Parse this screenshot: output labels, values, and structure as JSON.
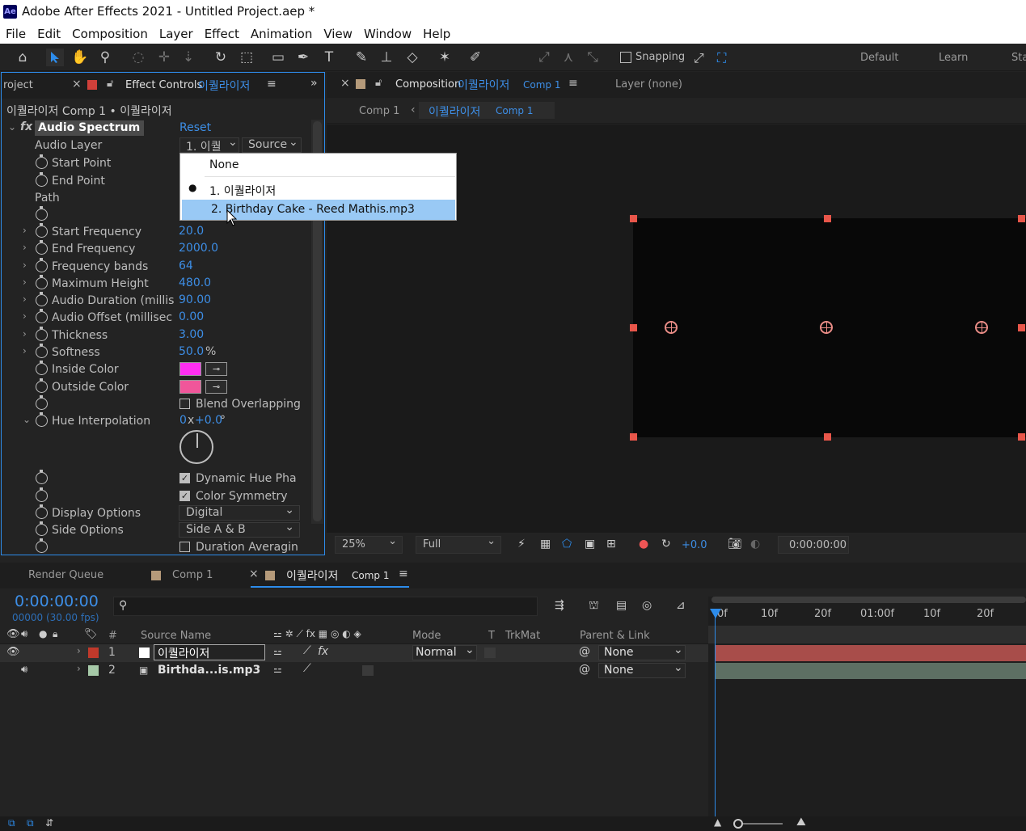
{
  "app": {
    "title": "Adobe After Effects 2021 - Untitled Project.aep *",
    "logo": "Ae"
  },
  "menu": [
    "File",
    "Edit",
    "Composition",
    "Layer",
    "Effect",
    "Animation",
    "View",
    "Window",
    "Help"
  ],
  "toolbar": {
    "snapping_label": "Snapping",
    "workspaces": [
      "Default",
      "Learn",
      "Sta"
    ]
  },
  "left_panel": {
    "tab_project": "roject",
    "tab_effect_controls": "Effect Controls",
    "tab_effect_controls_layer": "이퀄라이저",
    "breadcrumb": "이퀄라이저 Comp 1 • 이퀄라이저",
    "effect": {
      "name": "Audio Spectrum",
      "reset": "Reset",
      "audio_layer_label": "Audio Layer",
      "audio_layer_value": "1. 이퀄",
      "audio_layer_source": "Source",
      "props": {
        "start_point": "Start Point",
        "end_point": "End Point",
        "path": "Path",
        "start_frequency": {
          "label": "Start Frequency",
          "value": "20.0"
        },
        "end_frequency": {
          "label": "End Frequency",
          "value": "2000.0"
        },
        "frequency_bands": {
          "label": "Frequency bands",
          "value": "64"
        },
        "maximum_height": {
          "label": "Maximum Height",
          "value": "480.0"
        },
        "audio_duration": {
          "label": "Audio Duration (millis",
          "value": "90.00"
        },
        "audio_offset": {
          "label": "Audio Offset (millisec",
          "value": "0.00"
        },
        "thickness": {
          "label": "Thickness",
          "value": "3.00"
        },
        "softness": {
          "label": "Softness",
          "value": "50.0",
          "unit": "%"
        },
        "inside_color": {
          "label": "Inside Color",
          "color": "#ff2ef2"
        },
        "outside_color": {
          "label": "Outside Color",
          "color": "#f0569a"
        },
        "blend_overlapping": "Blend Overlapping",
        "hue_interpolation": {
          "label": "Hue Interpolation",
          "rev": "0",
          "x": "x",
          "deg": "+0.0",
          "unit": "°"
        },
        "dynamic_hue_phase": "Dynamic Hue Pha",
        "color_symmetry": "Color Symmetry",
        "display_options": {
          "label": "Display Options",
          "value": "Digital"
        },
        "side_options": {
          "label": "Side Options",
          "value": "Side A & B"
        },
        "duration_averaging": "Duration Averagin"
      }
    }
  },
  "popup": {
    "items": [
      "None",
      "1. 이퀄라이저",
      "2. Birthday Cake - Reed Mathis.mp3"
    ],
    "checked_index": 1,
    "highlighted_index": 2
  },
  "comp_panel": {
    "tab_label": "Composition",
    "tab_comp_name": "이퀄라이저",
    "tab_comp_suffix": "Comp 1",
    "layer_tab": "Layer (none)",
    "sub_comp1": "Comp 1",
    "sub_active_name": "이퀄라이저",
    "sub_active_suffix": "Comp 1",
    "zoom": "25%",
    "resolution": "Full",
    "exposure": "+0.0",
    "timecode": "0:00:00:00"
  },
  "timeline": {
    "tabs": {
      "render_queue": "Render Queue",
      "comp1": "Comp 1",
      "active_name": "이퀄라이저",
      "active_suffix": "Comp 1"
    },
    "timecode": "0:00:00:00",
    "frames": "00000 (30.00 fps)",
    "search_placeholder": "",
    "columns": {
      "hash": "#",
      "source_name": "Source Name",
      "mode": "Mode",
      "t": "T",
      "trkmat": "TrkMat",
      "parent": "Parent & Link"
    },
    "layers": [
      {
        "num": "1",
        "name": "이퀄라이저",
        "mode": "Normal",
        "parent": "None",
        "label_color": "#c0392b",
        "bar_color": "#a84d4a"
      },
      {
        "num": "2",
        "name": "Birthda...is.mp3",
        "parent": "None",
        "label_color": "#a6c9a8",
        "bar_color": "#5d6f63"
      }
    ],
    "ruler": [
      "0f",
      "10f",
      "20f",
      "01:00f",
      "10f",
      "20f"
    ]
  },
  "colors": {
    "accent": "#2d8ceb",
    "link": "#3d8ee6"
  }
}
